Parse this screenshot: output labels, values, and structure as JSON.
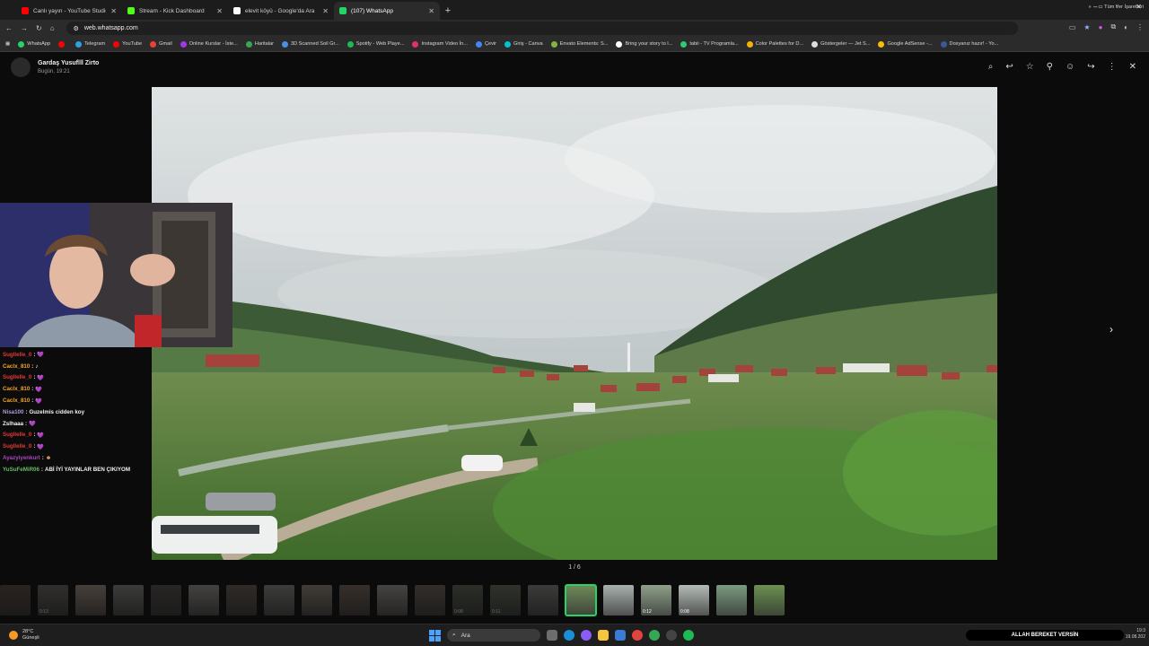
{
  "browser": {
    "tabs": [
      {
        "title": "Canlı yayın - YouTube Studio",
        "color": "#ff0000"
      },
      {
        "title": "Stream - Kick Dashboard",
        "color": "#53fc18"
      },
      {
        "title": "elevit köyü - Google'da Ara",
        "color": "#ffffff"
      },
      {
        "title": "(107) WhatsApp",
        "color": "#25d366"
      }
    ],
    "url": "web.whatsapp.com",
    "bookmarks": [
      {
        "label": "WhatsApp",
        "color": "#25d366"
      },
      {
        "label": "",
        "color": "#ff0000"
      },
      {
        "label": "Telegram",
        "color": "#2aa3e0"
      },
      {
        "label": "YouTube",
        "color": "#ff0000"
      },
      {
        "label": "Gmail",
        "color": "#ea4335"
      },
      {
        "label": "Online Kurslar - İste...",
        "color": "#a435f0"
      },
      {
        "label": "Haritalar",
        "color": "#34a853"
      },
      {
        "label": "3D Scanned Soil Gr...",
        "color": "#4a90e2"
      },
      {
        "label": "Spotify - Web Playe...",
        "color": "#1db954"
      },
      {
        "label": "Instagram Video İn...",
        "color": "#e1306c"
      },
      {
        "label": "Çevir",
        "color": "#4285f4"
      },
      {
        "label": "Giriş - Canva",
        "color": "#00c4cc"
      },
      {
        "label": "Envato Elements: S...",
        "color": "#82b541"
      },
      {
        "label": "Bring your story to l...",
        "color": "#ffffff"
      },
      {
        "label": "tabii - TV Programla...",
        "color": "#2ecc71"
      },
      {
        "label": "Color Palettes for D...",
        "color": "#f4b400"
      },
      {
        "label": "Göstergeler — Jet S...",
        "color": "#dddddd"
      },
      {
        "label": "Google AdSense -...",
        "color": "#fbbc05"
      },
      {
        "label": "Dosyanız hazır! - Yo...",
        "color": "#3b5998"
      }
    ],
    "bookmarks_more": "»",
    "all_bookmarks": "Tüm Yer İşaretleri"
  },
  "viewer": {
    "contact": "Gardaş Yusuflll Zirto",
    "time": "Bugün, 19:21",
    "counter": "1 / 6",
    "thumbnails": [
      {
        "color": "#5b4a42",
        "lit": false,
        "duration": ""
      },
      {
        "color": "#6e6a66",
        "lit": false,
        "duration": "0:13"
      },
      {
        "color": "#a7978a",
        "lit": false,
        "duration": ""
      },
      {
        "color": "#8b8a86",
        "lit": false,
        "duration": ""
      },
      {
        "color": "#57524e",
        "lit": false,
        "duration": ""
      },
      {
        "color": "#a29e9a",
        "lit": false,
        "duration": ""
      },
      {
        "color": "#6c5f58",
        "lit": false,
        "duration": ""
      },
      {
        "color": "#8f8e8a",
        "lit": false,
        "duration": ""
      },
      {
        "color": "#9a8d80",
        "lit": false,
        "duration": ""
      },
      {
        "color": "#7d6a5f",
        "lit": false,
        "duration": ""
      },
      {
        "color": "#a6a199",
        "lit": false,
        "duration": ""
      },
      {
        "color": "#72685e",
        "lit": false,
        "duration": ""
      },
      {
        "color": "#5e6a55",
        "lit": false,
        "duration": "0:08"
      },
      {
        "color": "#6a7560",
        "lit": false,
        "duration": "0:11"
      },
      {
        "color": "#8a8d88",
        "lit": false,
        "duration": ""
      },
      {
        "color": "#6f8a5a",
        "lit": true,
        "duration": "",
        "current": true
      },
      {
        "color": "#a8b0ad",
        "lit": true,
        "duration": ""
      },
      {
        "color": "#8fa08a",
        "lit": true,
        "duration": "0:12"
      },
      {
        "color": "#b4bcb6",
        "lit": true,
        "duration": "0:08"
      },
      {
        "color": "#7a9a7e",
        "lit": true,
        "duration": ""
      },
      {
        "color": "#6c8f52",
        "lit": true,
        "duration": ""
      }
    ]
  },
  "chat": [
    {
      "user": "Sugllelle_0",
      "message": "",
      "color": "#e53935",
      "emote": "heart"
    },
    {
      "user": "Caclx_810",
      "message": "",
      "color": "#f5a623",
      "emote": "glyph"
    },
    {
      "user": "Sugllelle_0",
      "message": "",
      "color": "#e53935",
      "emote": "heart"
    },
    {
      "user": "Caclx_810",
      "message": "",
      "color": "#f5a623",
      "emote": "heart"
    },
    {
      "user": "Caclx_810",
      "message": "",
      "color": "#f5a623",
      "emote": "heart"
    },
    {
      "user": "Nisa100",
      "message": "Guzelmis cidden koy",
      "color": "#b39ddb",
      "emote": ""
    },
    {
      "user": "Zslhaaa",
      "message": "",
      "color": "#f5f5f5",
      "emote": "heart"
    },
    {
      "user": "Sugllelle_0",
      "message": "",
      "color": "#e53935",
      "emote": "heart"
    },
    {
      "user": "Sugllelle_0",
      "message": "",
      "color": "#e53935",
      "emote": "heart"
    },
    {
      "user": "Ayazyiyenkurt",
      "message": "",
      "color": "#ab47bc",
      "emote": "face"
    },
    {
      "user": "YuSuFeMiR06",
      "message": "ABİ İYİ YAYINLAR BEN ÇIKIYOM",
      "color": "#66bb6a",
      "emote": ""
    }
  ],
  "taskbar": {
    "temperature": "28°C",
    "weather": "Güneşli",
    "search": "Ara",
    "ticker": "ALLAH BEREKET VERSİN",
    "time": "19:3",
    "date": "19.08.202"
  }
}
